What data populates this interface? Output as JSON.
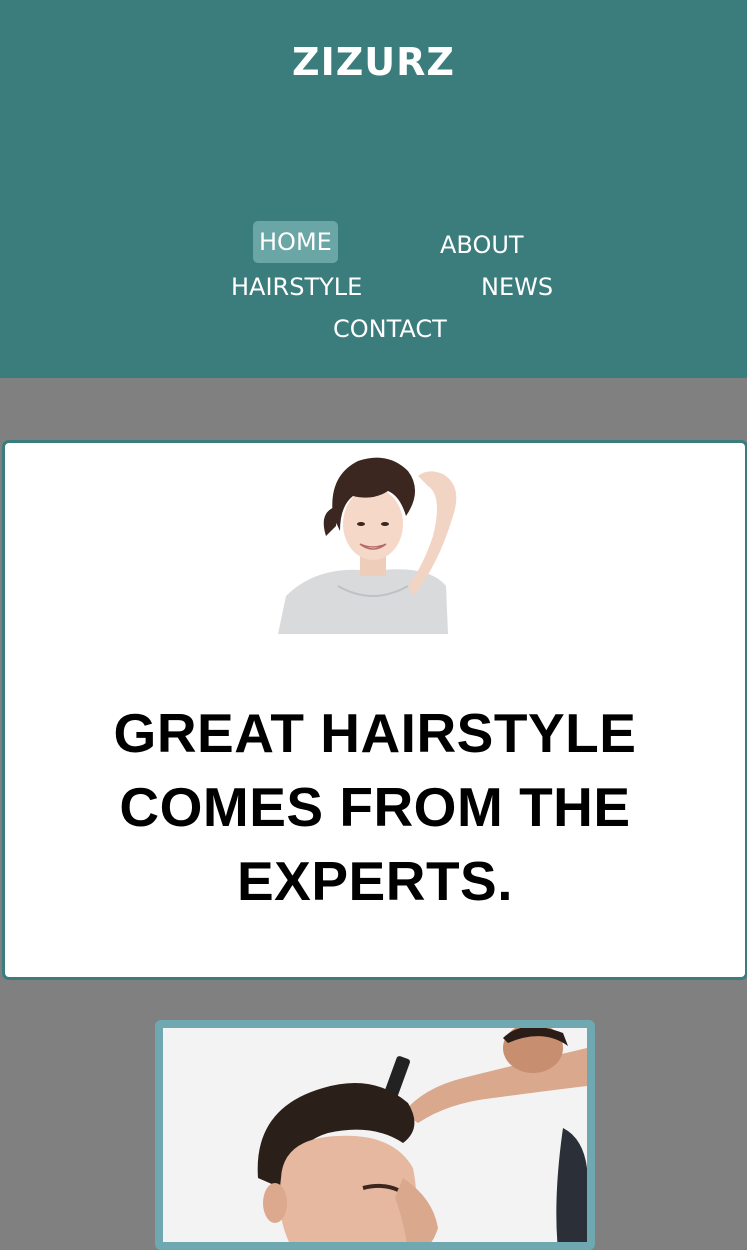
{
  "header": {
    "title": "ZIZURZ",
    "nav": [
      {
        "label": "HOME",
        "active": true
      },
      {
        "label": "ABOUT",
        "active": false
      },
      {
        "label": "HAIRSTYLE",
        "active": false
      },
      {
        "label": "NEWS",
        "active": false
      },
      {
        "label": "CONTACT",
        "active": false
      }
    ]
  },
  "hero": {
    "headline": "GREAT HAIRSTYLE COMES FROM THE EXPERTS.",
    "image": "woman-short-hair-photo"
  },
  "feature": {
    "image": "barber-cutting-hair-photo"
  },
  "colors": {
    "header_bg": "#3a7d7c",
    "page_bg": "#808080",
    "card_border": "#3a7d7c",
    "feature_border": "#6fa8b0",
    "active_nav_bg": "#6aa6a5"
  }
}
